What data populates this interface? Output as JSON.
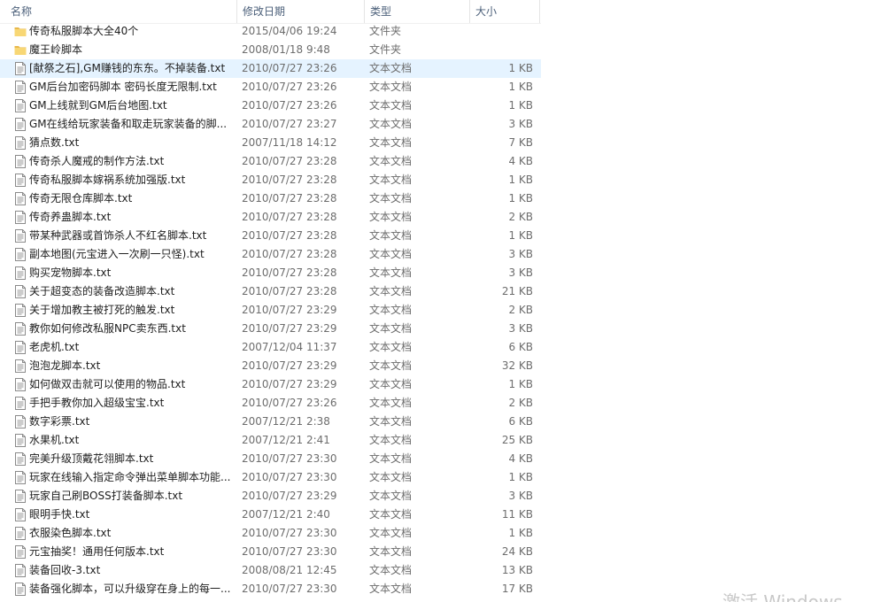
{
  "columns": {
    "name": "名称",
    "date": "修改日期",
    "type": "类型",
    "size": "大小"
  },
  "watermark": "激活 Windows",
  "colors": {
    "folder": "#f8d775",
    "folder_dark": "#e8b84a",
    "hover_row": "#e5f3ff",
    "header_text": "#4c607a"
  },
  "files": [
    {
      "icon": "folder-icon",
      "name": "传奇私服脚本大全40个",
      "date": "2015/04/06 19:24",
      "type": "文件夹",
      "size": ""
    },
    {
      "icon": "folder-icon",
      "name": "魔王岭脚本",
      "date": "2008/01/18 9:48",
      "type": "文件夹",
      "size": ""
    },
    {
      "icon": "text-file-icon",
      "name": "[献祭之石],GM赚钱的东东。不掉装备.txt",
      "date": "2010/07/27 23:26",
      "type": "文本文档",
      "size": "1 KB",
      "highlight": true
    },
    {
      "icon": "text-file-icon",
      "name": "GM后台加密码脚本 密码长度无限制.txt",
      "date": "2010/07/27 23:26",
      "type": "文本文档",
      "size": "1 KB"
    },
    {
      "icon": "text-file-icon",
      "name": "GM上线就到GM后台地图.txt",
      "date": "2010/07/27 23:26",
      "type": "文本文档",
      "size": "1 KB"
    },
    {
      "icon": "text-file-icon",
      "name": "GM在线给玩家装备和取走玩家装备的脚...",
      "date": "2010/07/27 23:27",
      "type": "文本文档",
      "size": "3 KB"
    },
    {
      "icon": "text-file-icon",
      "name": "猜点数.txt",
      "date": "2007/11/18 14:12",
      "type": "文本文档",
      "size": "7 KB"
    },
    {
      "icon": "text-file-icon",
      "name": "传奇杀人魔戒的制作方法.txt",
      "date": "2010/07/27 23:28",
      "type": "文本文档",
      "size": "4 KB"
    },
    {
      "icon": "text-file-icon",
      "name": "传奇私服脚本嫁祸系统加强版.txt",
      "date": "2010/07/27 23:28",
      "type": "文本文档",
      "size": "1 KB"
    },
    {
      "icon": "text-file-icon",
      "name": "传奇无限仓库脚本.txt",
      "date": "2010/07/27 23:28",
      "type": "文本文档",
      "size": "1 KB"
    },
    {
      "icon": "text-file-icon",
      "name": "传奇养蛊脚本.txt",
      "date": "2010/07/27 23:28",
      "type": "文本文档",
      "size": "2 KB"
    },
    {
      "icon": "text-file-icon",
      "name": "带某种武器或首饰杀人不红名脚本.txt",
      "date": "2010/07/27 23:28",
      "type": "文本文档",
      "size": "1 KB"
    },
    {
      "icon": "text-file-icon",
      "name": "副本地图(元宝进入一次刷一只怪).txt",
      "date": "2010/07/27 23:28",
      "type": "文本文档",
      "size": "3 KB"
    },
    {
      "icon": "text-file-icon",
      "name": "购买宠物脚本.txt",
      "date": "2010/07/27 23:28",
      "type": "文本文档",
      "size": "3 KB"
    },
    {
      "icon": "text-file-icon",
      "name": "关于超变态的装备改造脚本.txt",
      "date": "2010/07/27 23:28",
      "type": "文本文档",
      "size": "21 KB"
    },
    {
      "icon": "text-file-icon",
      "name": "关于增加教主被打死的触发.txt",
      "date": "2010/07/27 23:29",
      "type": "文本文档",
      "size": "2 KB"
    },
    {
      "icon": "text-file-icon",
      "name": "教你如何修改私服NPC卖东西.txt",
      "date": "2010/07/27 23:29",
      "type": "文本文档",
      "size": "3 KB"
    },
    {
      "icon": "text-file-icon",
      "name": "老虎机.txt",
      "date": "2007/12/04 11:37",
      "type": "文本文档",
      "size": "6 KB"
    },
    {
      "icon": "text-file-icon",
      "name": "泡泡龙脚本.txt",
      "date": "2010/07/27 23:29",
      "type": "文本文档",
      "size": "32 KB"
    },
    {
      "icon": "text-file-icon",
      "name": "如何做双击就可以使用的物品.txt",
      "date": "2010/07/27 23:29",
      "type": "文本文档",
      "size": "1 KB"
    },
    {
      "icon": "text-file-icon",
      "name": "手把手教你加入超级宝宝.txt",
      "date": "2010/07/27 23:26",
      "type": "文本文档",
      "size": "2 KB"
    },
    {
      "icon": "text-file-icon",
      "name": "数字彩票.txt",
      "date": "2007/12/21 2:38",
      "type": "文本文档",
      "size": "6 KB"
    },
    {
      "icon": "text-file-icon",
      "name": "水果机.txt",
      "date": "2007/12/21 2:41",
      "type": "文本文档",
      "size": "25 KB"
    },
    {
      "icon": "text-file-icon",
      "name": "完美升级顶戴花翎脚本.txt",
      "date": "2010/07/27 23:30",
      "type": "文本文档",
      "size": "4 KB"
    },
    {
      "icon": "text-file-icon",
      "name": "玩家在线输入指定命令弹出菜单脚本功能...",
      "date": "2010/07/27 23:30",
      "type": "文本文档",
      "size": "1 KB"
    },
    {
      "icon": "text-file-icon",
      "name": "玩家自己刷BOSS打装备脚本.txt",
      "date": "2010/07/27 23:29",
      "type": "文本文档",
      "size": "3 KB"
    },
    {
      "icon": "text-file-icon",
      "name": "眼明手快.txt",
      "date": "2007/12/21 2:40",
      "type": "文本文档",
      "size": "11 KB"
    },
    {
      "icon": "text-file-icon",
      "name": "衣服染色脚本.txt",
      "date": "2010/07/27 23:30",
      "type": "文本文档",
      "size": "1 KB"
    },
    {
      "icon": "text-file-icon",
      "name": "元宝抽奖！通用任何版本.txt",
      "date": "2010/07/27 23:30",
      "type": "文本文档",
      "size": "24 KB"
    },
    {
      "icon": "text-file-icon",
      "name": "装备回收-3.txt",
      "date": "2008/08/21 12:45",
      "type": "文本文档",
      "size": "13 KB"
    },
    {
      "icon": "text-file-icon",
      "name": "装备强化脚本，可以升级穿在身上的每一...",
      "date": "2010/07/27 23:30",
      "type": "文本文档",
      "size": "17 KB"
    }
  ]
}
